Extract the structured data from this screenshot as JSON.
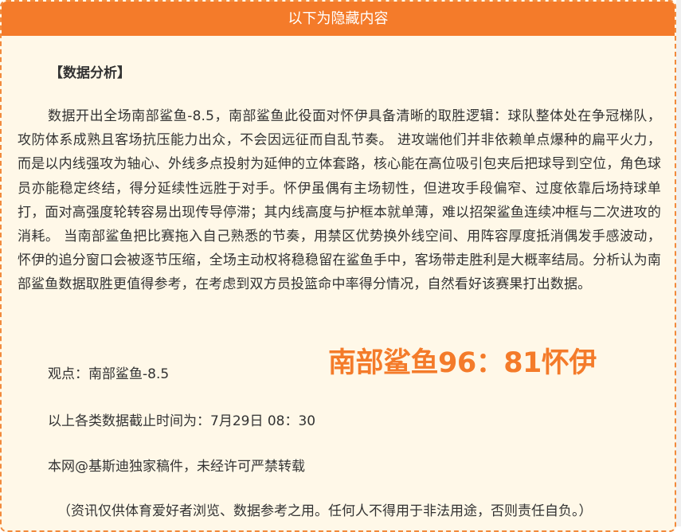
{
  "header": {
    "title": "以下为隐藏内容"
  },
  "article": {
    "section_title": "【数据分析】",
    "paragraph": "数据开出全场南部鲨鱼-8.5，南部鲨鱼此役面对怀伊具备清晰的取胜逻辑：球队整体处在争冠梯队，攻防体系成熟且客场抗压能力出众，不会因远征而自乱节奏。 进攻端他们并非依赖单点爆种的扁平火力，而是以内线强攻为轴心、外线多点投射为延伸的立体套路，核心能在高位吸引包夹后把球导到空位，角色球员亦能稳定终结，得分延续性远胜于对手。怀伊虽偶有主场韧性，但进攻手段偏窄、过度依靠后场持球单打，面对高强度轮转容易出现传导停滞；其内线高度与护框本就单薄，难以招架鲨鱼连续冲框与二次进攻的消耗。 当南部鲨鱼把比赛拖入自己熟悉的节奏，用禁区优势换外线空间、用阵容厚度抵消偶发手感波动，怀伊的追分窗口会被逐节压缩，全场主动权将稳稳留在鲨鱼手中，客场带走胜利是大概率结局。分析认为南部鲨鱼数据取胜更值得参考，在考虑到双方员投篮命中率得分情况，自然看好该赛果打出数据。",
    "viewpoint": "观点：南部鲨鱼-8.5",
    "score": "南部鲨鱼96：81怀伊",
    "cutoff": "以上各类数据截止时间为：7月29日 08：30",
    "copyright": "本网@基斯迪独家稿件，未经许可严禁转载",
    "disclaimer": "（资讯仅供体育爱好者浏览、数据参考之用。任何人不得用于非法用途，否则责任自负。）"
  },
  "colors": {
    "accent": "#f47b2a",
    "background": "#fff8e8",
    "text": "#333333"
  }
}
